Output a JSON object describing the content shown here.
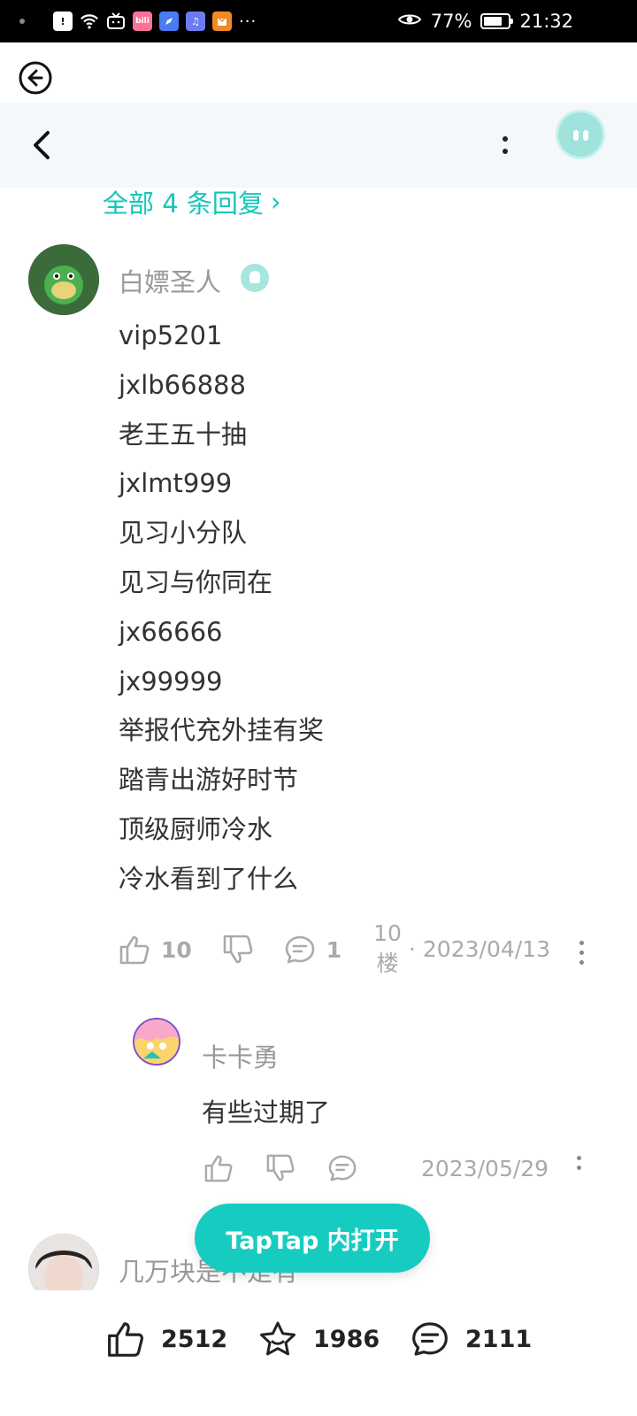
{
  "status_bar": {
    "time": "21:32",
    "battery_percent": "77%",
    "battery_level": 0.77,
    "more": "···",
    "app_icons": [
      {
        "name": "alert-app-icon",
        "label": "!",
        "color": "#ffffff",
        "text_color": "#000000"
      },
      {
        "name": "wifi-icon",
        "label": "",
        "color": "#000000"
      },
      {
        "name": "tv-app-icon",
        "label": "",
        "color": "#000000"
      },
      {
        "name": "bilibili-app-icon",
        "label": "bili",
        "color": "#fb7299"
      },
      {
        "name": "compass-app-icon",
        "label": "",
        "color": "#4a7bf0"
      },
      {
        "name": "music-app-icon",
        "label": "♫",
        "color": "#6c7cf0"
      },
      {
        "name": "box-app-icon",
        "label": "",
        "color": "#f08a24"
      }
    ]
  },
  "header": {
    "accent": "#14c6b8"
  },
  "replies_link": {
    "label": "全部 4 条回复",
    "chevron": "›"
  },
  "comment": {
    "user": "白嫖圣人",
    "lines": [
      "vip5201",
      "jxlb66888",
      "老王五十抽",
      "jxlmt999",
      "见习小分队",
      "见习与你同在",
      "jx66666",
      "jx99999",
      "举报代充外挂有奖",
      "踏青出游好时节",
      "顶级厨师冷水",
      "冷水看到了什么"
    ],
    "likes": "10",
    "comments": "1",
    "floor_number": "10",
    "floor_unit": "楼",
    "date": "· 2023/04/13"
  },
  "reply": {
    "user": "卡卡勇",
    "text": "有些过期了",
    "date": "2023/05/29"
  },
  "next_comment": {
    "user_partial": "几万块是不是有"
  },
  "open_button": {
    "label": "TapTap 内打开"
  },
  "bottom_bar": {
    "likes": "2512",
    "favorites": "1986",
    "comments": "2111"
  }
}
